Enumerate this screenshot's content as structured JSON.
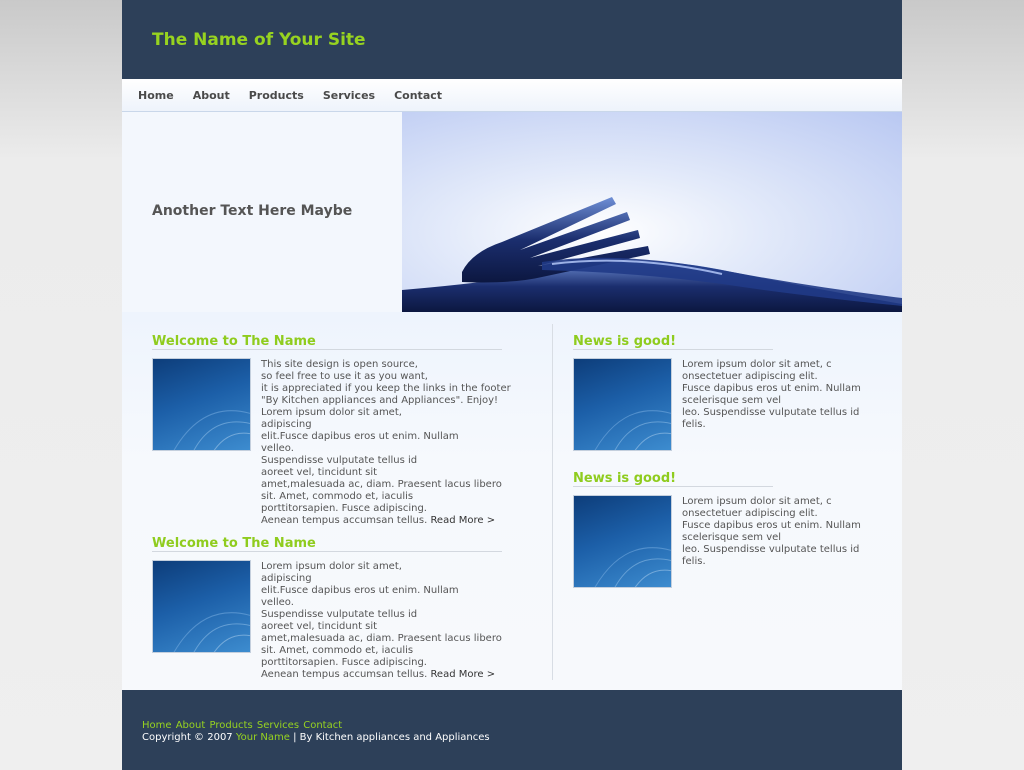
{
  "header": {
    "site_title": "The Name of Your Site"
  },
  "nav": {
    "items": [
      "Home",
      "About",
      "Products",
      "Services",
      "Contact"
    ]
  },
  "banner": {
    "text": "Another Text Here Maybe"
  },
  "left_column": {
    "sections": [
      {
        "title": "Welcome to The Name",
        "body": "This site design is open source,\nso feel free to use it as you want,\nit is appreciated if you keep the links in the footer\n\"By Kitchen appliances and Appliances\". Enjoy!\nLorem ipsum dolor sit amet,\nadipiscing\nelit.Fusce dapibus eros ut enim. Nullam\nvelleo.\nSuspendisse vulputate tellus id\naoreet vel, tincidunt sit\namet,malesuada ac, diam. Praesent lacus libero\nsit. Amet, commodo et, iaculis\nporttitorsapien. Fusce adipiscing.\nAenean tempus accumsan tellus. ",
        "read_more": "Read More >"
      },
      {
        "title": "Welcome to The Name",
        "body": "Lorem ipsum dolor sit amet,\nadipiscing\nelit.Fusce dapibus eros ut enim. Nullam\nvelleo.\nSuspendisse vulputate tellus id\naoreet vel, tincidunt sit\namet,malesuada ac, diam. Praesent lacus libero\nsit. Amet, commodo et, iaculis\nporttitorsapien. Fusce adipiscing.\nAenean tempus accumsan tellus. ",
        "read_more": "Read More >"
      }
    ]
  },
  "right_column": {
    "sections": [
      {
        "title": "News is good!",
        "body": "Lorem ipsum dolor sit amet, c\nonsectetuer adipiscing elit.\nFusce dapibus eros ut enim. Nullam\nscelerisque sem vel\nleo. Suspendisse vulputate tellus id\nfelis."
      },
      {
        "title": "News is good!",
        "body": "Lorem ipsum dolor sit amet, c\nonsectetuer adipiscing elit.\nFusce dapibus eros ut enim. Nullam\nscelerisque sem vel\nleo. Suspendisse vulputate tellus id\nfelis."
      }
    ]
  },
  "footer": {
    "nav": [
      "Home",
      "About",
      "Products",
      "Services",
      "Contact"
    ],
    "copyright_prefix": "Copyright © 2007 ",
    "copyright_name": "Your Name",
    "copyright_suffix": " | By Kitchen appliances and Appliances"
  },
  "colors": {
    "header_bg": "#2d4059",
    "accent_green": "#97d320",
    "body_text": "#555555"
  },
  "icons": {
    "banner": "fork-knife-photo",
    "thumbnails": "abstract-blue-wave-image"
  }
}
